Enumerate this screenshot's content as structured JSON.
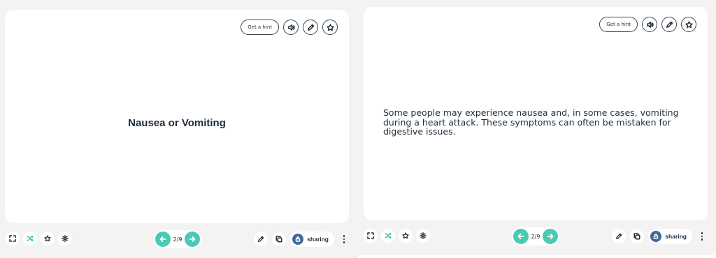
{
  "front": {
    "term": "Nausea or Vomiting"
  },
  "back": {
    "definition": "Some people may experience nausea and, in some cases, vomiting during a heart attack. These symptoms can often be mistaken for digestive issues."
  },
  "card_tools": {
    "hint_label": "Get a hint",
    "icons": [
      "speaker-icon",
      "pencil-icon",
      "star-icon"
    ]
  },
  "pager": {
    "count": "2/9"
  },
  "bottom_bar": {
    "sharing_label": "sharing",
    "left_icons": [
      "fullscreen-icon",
      "shuffle-icon",
      "star-icon",
      "settings-icon"
    ],
    "right_icons": [
      "pencil-icon",
      "copy-icon",
      "lock-icon",
      "more-icon"
    ]
  },
  "colors": {
    "accent": "#4cc9b5",
    "share": "#3e6a9b",
    "text": "#1f2d3a"
  }
}
